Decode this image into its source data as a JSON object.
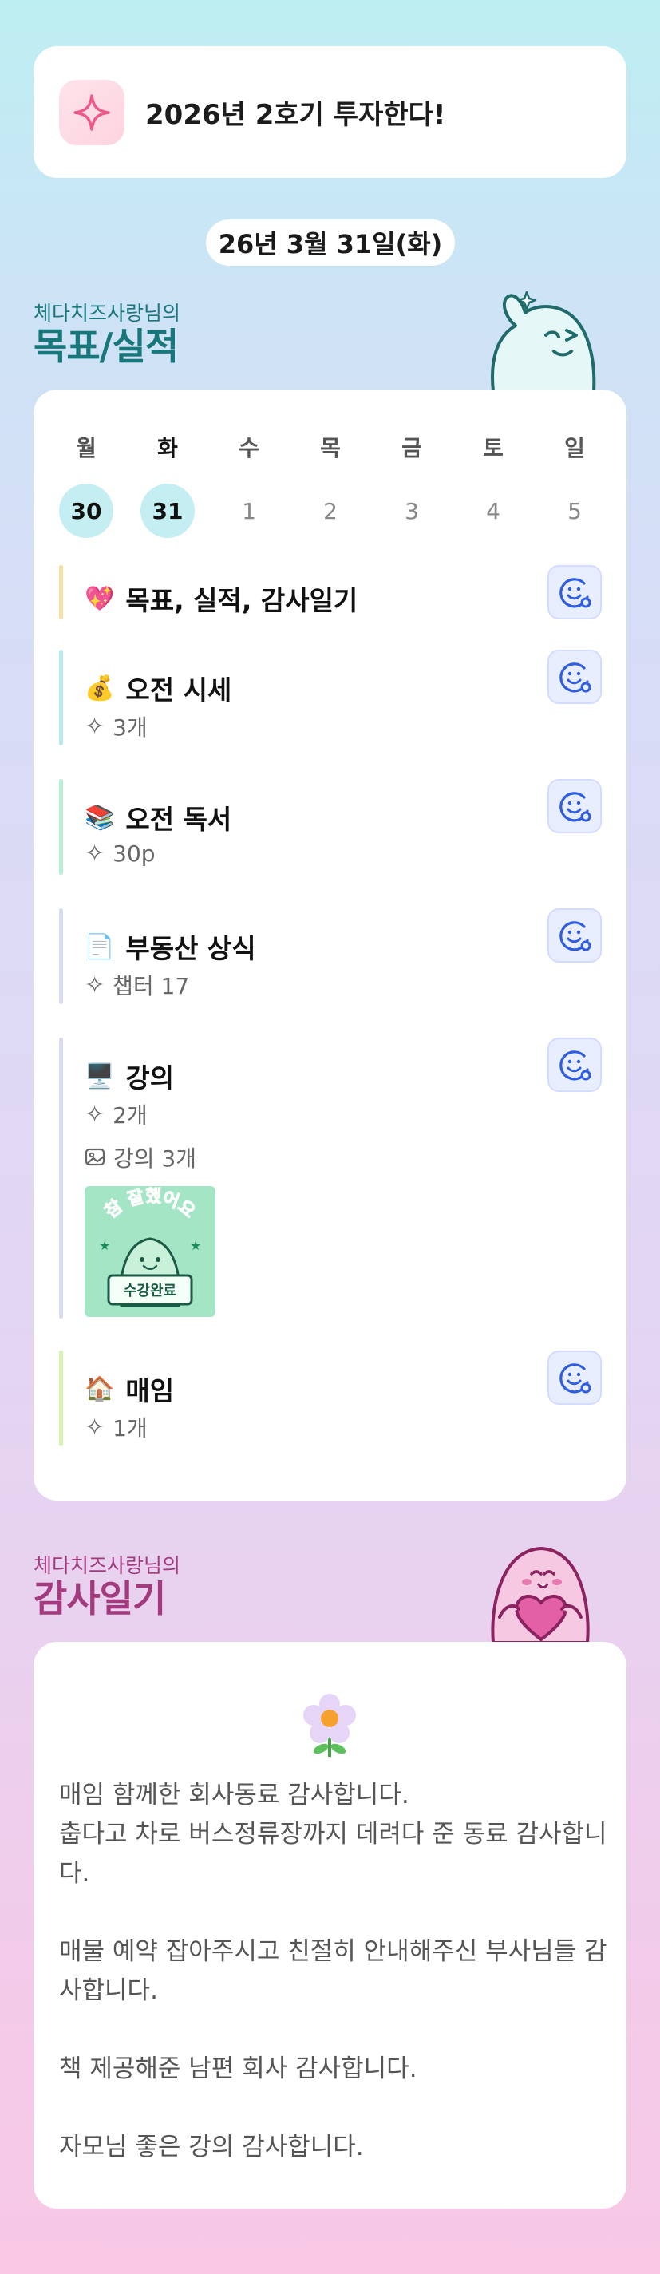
{
  "goal_banner": {
    "icon": "sparkle-icon",
    "text": "2026년 2호기 투자한다!"
  },
  "date_label": "26년 3월 31일(화)",
  "goals_section": {
    "subtitle": "체다치즈사랑님의",
    "title": "목표/실적"
  },
  "week": [
    {
      "weekday": "월",
      "date": "30",
      "highlight": true,
      "today": false
    },
    {
      "weekday": "화",
      "date": "31",
      "highlight": true,
      "today": true
    },
    {
      "weekday": "수",
      "date": "1",
      "highlight": false,
      "today": false
    },
    {
      "weekday": "목",
      "date": "2",
      "highlight": false,
      "today": false
    },
    {
      "weekday": "금",
      "date": "3",
      "highlight": false,
      "today": false
    },
    {
      "weekday": "토",
      "date": "4",
      "highlight": false,
      "today": false
    },
    {
      "weekday": "일",
      "date": "5",
      "highlight": false,
      "today": false
    }
  ],
  "tasks": [
    {
      "emoji": "💖",
      "name": "목표, 실적, 감사일기",
      "color": "#f6dfa4",
      "meta": []
    },
    {
      "emoji": "💰",
      "name": "오전 시세",
      "color": "#b7e9ec",
      "meta": [
        {
          "icon": "sparkle-icon",
          "text": "3개"
        }
      ]
    },
    {
      "emoji": "📚",
      "name": "오전 독서",
      "color": "#b9ecd6",
      "meta": [
        {
          "icon": "sparkle-icon",
          "text": "30p"
        }
      ]
    },
    {
      "emoji": "📄",
      "name": "부동산 상식",
      "color": "#d7dcf4",
      "meta": [
        {
          "icon": "sparkle-icon",
          "text": "챕터 17"
        }
      ]
    },
    {
      "emoji": "🖥️",
      "name": "강의",
      "color": "#d7dcf4",
      "meta": [
        {
          "icon": "sparkle-icon",
          "text": "2개"
        },
        {
          "icon": "image-icon",
          "text": "강의 3개"
        }
      ],
      "sticker": {
        "top_text": "참 잘했어요",
        "sign_text": "수강완료"
      }
    },
    {
      "emoji": "🏠",
      "name": "매임",
      "color": "#d9f0ae",
      "meta": [
        {
          "icon": "sparkle-icon",
          "text": "1개"
        }
      ]
    }
  ],
  "gratitude_section": {
    "subtitle": "체다치즈사랑님의",
    "title": "감사일기",
    "entries": [
      "매임 함께한 회사동료 감사합니다.",
      "춥다고 차로 버스정류장까지 데려다 준 동료 감사합니다.",
      "",
      "매물 예약 잡아주시고 친절히 안내해주신 부사님들 감사합니다.",
      "",
      "책 제공해준 남편 회사 감사합니다.",
      "",
      "자모님 좋은 강의 감사합니다."
    ]
  },
  "colors": {
    "teal": "#17777a",
    "magenta": "#a23a7d",
    "highlight": "#c5eef2",
    "face_button": "#e9eeff"
  }
}
